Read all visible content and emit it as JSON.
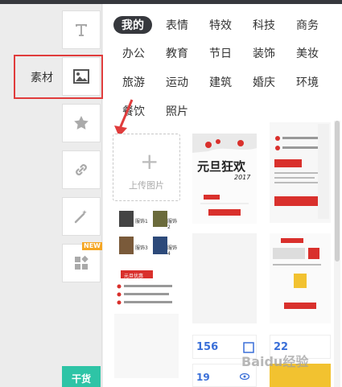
{
  "left_panel": {
    "active_label": "素材",
    "new_badge": "NEW",
    "promo_text": "干货"
  },
  "categories": [
    "我的",
    "表情",
    "特效",
    "科技",
    "商务",
    "办公",
    "教育",
    "节日",
    "装饰",
    "美妆",
    "旅游",
    "运动",
    "建筑",
    "婚庆",
    "环境",
    "餐饮",
    "照片"
  ],
  "upload": {
    "plus": "+",
    "label": "上传图片"
  },
  "thumbs": {
    "newyear_title": "元旦狂欢",
    "newyear_year": "2017",
    "clothes_labels": [
      "服饰1",
      "服饰2",
      "服饰3",
      "服饰4"
    ],
    "red_banner": "元旦优惠",
    "stat_a": "156",
    "stat_b": "22",
    "stat_c": "19"
  },
  "watermark": "Baidu经验",
  "colors": {
    "accent_red": "#e03c3c",
    "dark": "#36383d",
    "promo": "#2ec4a6"
  }
}
